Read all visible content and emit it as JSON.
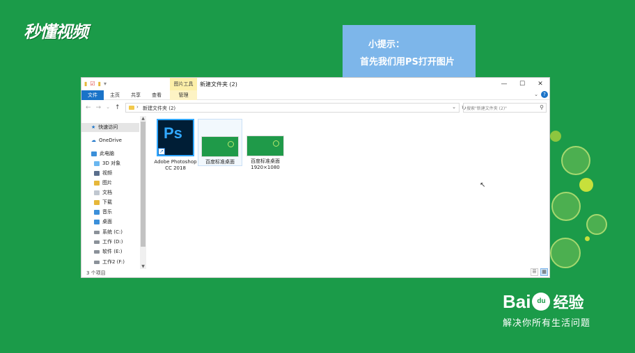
{
  "brand": {
    "logo": "秒懂视频"
  },
  "tip": {
    "line1": "小提示：",
    "line2": "首先我们用PS打开图片"
  },
  "window": {
    "title": "新建文件夹 (2)",
    "context_tab": "图片工具",
    "ribbon_tabs": [
      "文件",
      "主页",
      "共享",
      "查看",
      "管理"
    ],
    "address": "新建文件夹 (2)",
    "search_placeholder": "搜索\"新建文件夹 (2)\"",
    "minimize": "—",
    "maximize": "☐",
    "close": "✕"
  },
  "sidebar": {
    "items": [
      {
        "label": "快速访问",
        "icon": "star-icon"
      },
      {
        "label": "OneDrive",
        "icon": "cloud-icon"
      },
      {
        "label": "此电脑",
        "icon": "computer-icon"
      },
      {
        "label": "3D 对象",
        "icon": "3d-object-icon"
      },
      {
        "label": "视频",
        "icon": "video-folder-icon"
      },
      {
        "label": "图片",
        "icon": "picture-folder-icon"
      },
      {
        "label": "文档",
        "icon": "document-folder-icon"
      },
      {
        "label": "下载",
        "icon": "download-folder-icon"
      },
      {
        "label": "音乐",
        "icon": "music-folder-icon"
      },
      {
        "label": "桌面",
        "icon": "desktop-folder-icon"
      },
      {
        "label": "系统 (C:)",
        "icon": "drive-icon"
      },
      {
        "label": "工作 (D:)",
        "icon": "drive-icon"
      },
      {
        "label": "软件 (E:)",
        "icon": "drive-icon"
      },
      {
        "label": "工作2 (F:)",
        "icon": "drive-icon"
      }
    ]
  },
  "files": [
    {
      "label": "Adobe Photoshop CC 2018",
      "icon": "photoshop-icon",
      "icon_text": "Ps"
    },
    {
      "label": "百度标准桌面",
      "icon": "image-thumbnail-icon"
    },
    {
      "label": "百度标准桌面 1920×1080",
      "icon": "image-thumbnail-icon"
    }
  ],
  "status": {
    "count": "3 个项目"
  },
  "footer": {
    "brand": "Bai",
    "brand_du": "du",
    "brand_tail": "经验",
    "slogan": "解决你所有生活问题"
  },
  "colors": {
    "background": "#1b9b49",
    "tip": "#7db6ea",
    "accent": "#1a73c8",
    "ps_blue": "#31a8ff"
  }
}
